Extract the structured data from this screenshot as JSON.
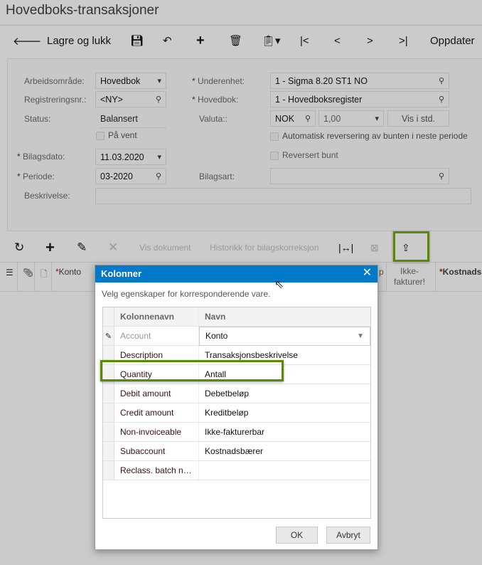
{
  "title": "Hovedboks-transaksjoner",
  "toolbar": {
    "save_close": "Lagre og lukk",
    "refresh": "Oppdater"
  },
  "form": {
    "workspace_label": "Arbeidsområde:",
    "workspace": "Hovedbok",
    "regno_label": "Registreringsnr.:",
    "regno": "<NY>",
    "status_label": "Status:",
    "status": "Balansert",
    "onhold_label": "På vent",
    "date_label": "Bilagsdato:",
    "date": "11.03.2020",
    "period_label": "Periode:",
    "period": "03-2020",
    "desc_label": "Beskrivelse:",
    "subunit_label": "Underenhet:",
    "subunit": "1 - Sigma 8.20 ST1 NO",
    "ledger_label": "Hovedbok:",
    "ledger": "1 - Hovedboksregister",
    "currency_label": "Valuta::",
    "currency": "NOK",
    "rate": "1,00",
    "show_std": "Vis i std.",
    "auto_reverse": "Automatisk reversering av bunten i neste periode",
    "reversed": "Reversert bunt",
    "doctype_label": "Bilagsart:"
  },
  "grid": {
    "view_doc": "Vis dokument",
    "history": "Historikk for bilagskorreksjon",
    "cols": {
      "account": "Konto",
      "p": "p",
      "noninv": "Ikke-fakturer!",
      "sub": "Kostnads"
    }
  },
  "dialog": {
    "title": "Kolonner",
    "hint": "Velg egenskaper for korresponderende vare.",
    "col_name": "Kolonnenavn",
    "name": "Navn",
    "rows": [
      {
        "col": "Account",
        "name": "Konto"
      },
      {
        "col": "Description",
        "name": "Transaksjonsbeskrivelse"
      },
      {
        "col": "Quantity",
        "name": "Antall"
      },
      {
        "col": "Debit amount",
        "name": "Debetbeløp"
      },
      {
        "col": "Credit amount",
        "name": "Kreditbeløp"
      },
      {
        "col": "Non-invoiceable",
        "name": "Ikke-fakturerbar"
      },
      {
        "col": "Subaccount",
        "name": "Kostnadsbærer"
      },
      {
        "col": "Reclass. batch n…",
        "name": ""
      }
    ],
    "ok": "OK",
    "cancel": "Avbryt"
  },
  "colors": {
    "accent": "#0079c9",
    "highlight": "#5a8a00"
  }
}
